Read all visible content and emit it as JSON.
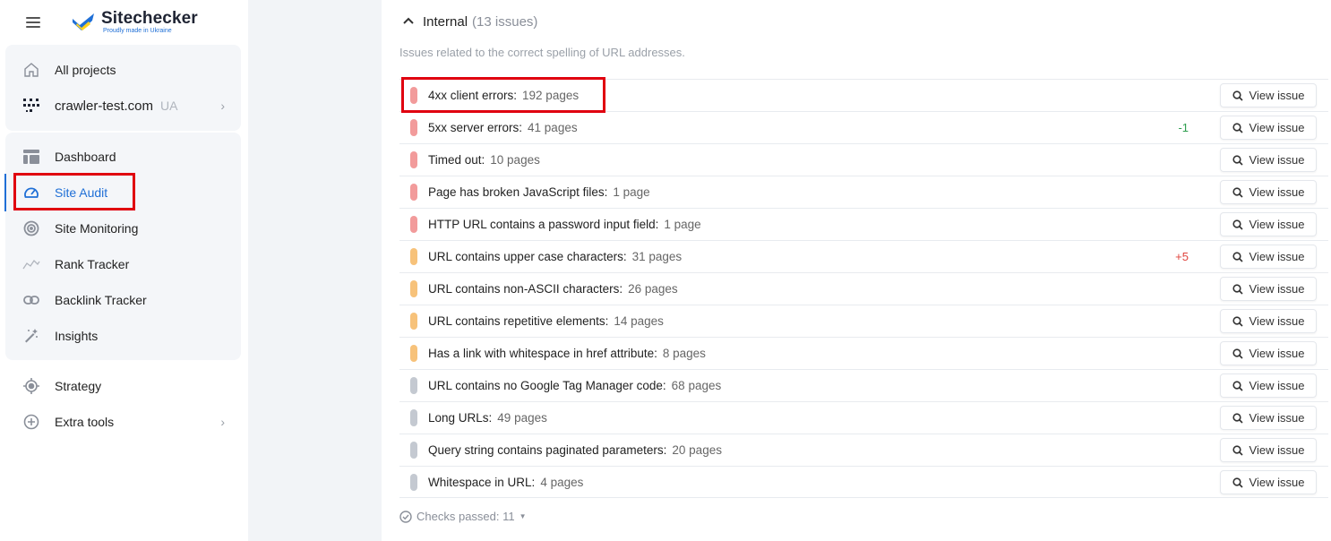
{
  "brand": {
    "name": "Sitechecker",
    "tagline": "Proudly made in Ukraine"
  },
  "sidebar": {
    "all_projects": "All projects",
    "project": {
      "name": "crawler-test.com",
      "region": "UA"
    },
    "items": [
      {
        "label": "Dashboard",
        "icon": "dashboard-icon"
      },
      {
        "label": "Site Audit",
        "icon": "gauge-icon",
        "active": true
      },
      {
        "label": "Site Monitoring",
        "icon": "radar-icon"
      },
      {
        "label": "Rank Tracker",
        "icon": "trend-icon"
      },
      {
        "label": "Backlink Tracker",
        "icon": "link-icon"
      },
      {
        "label": "Insights",
        "icon": "magic-wand-icon"
      }
    ],
    "strategy": "Strategy",
    "extra_tools": "Extra tools"
  },
  "section": {
    "title": "Internal",
    "count": "(13 issues)",
    "description": "Issues related to the correct spelling of URL addresses."
  },
  "issues": [
    {
      "name": "4xx client errors:",
      "pages": "192 pages",
      "severity": "critical",
      "delta": ""
    },
    {
      "name": "5xx server errors:",
      "pages": "41 pages",
      "severity": "critical",
      "delta": "-1"
    },
    {
      "name": "Timed out:",
      "pages": "10 pages",
      "severity": "critical",
      "delta": ""
    },
    {
      "name": "Page has broken JavaScript files:",
      "pages": "1 page",
      "severity": "critical",
      "delta": ""
    },
    {
      "name": "HTTP URL contains a password input field:",
      "pages": "1 page",
      "severity": "critical",
      "delta": ""
    },
    {
      "name": "URL contains upper case characters:",
      "pages": "31 pages",
      "severity": "warning",
      "delta": "+5"
    },
    {
      "name": "URL contains non-ASCII characters:",
      "pages": "26 pages",
      "severity": "warning",
      "delta": ""
    },
    {
      "name": "URL contains repetitive elements:",
      "pages": "14 pages",
      "severity": "warning",
      "delta": ""
    },
    {
      "name": "Has a link with whitespace in href attribute:",
      "pages": "8 pages",
      "severity": "warning",
      "delta": ""
    },
    {
      "name": "URL contains no Google Tag Manager code:",
      "pages": "68 pages",
      "severity": "notice",
      "delta": ""
    },
    {
      "name": "Long URLs:",
      "pages": "49 pages",
      "severity": "notice",
      "delta": ""
    },
    {
      "name": "Query string contains paginated parameters:",
      "pages": "20 pages",
      "severity": "notice",
      "delta": ""
    },
    {
      "name": "Whitespace in URL:",
      "pages": "4 pages",
      "severity": "notice",
      "delta": ""
    }
  ],
  "view_issue_label": "View issue",
  "checks_passed": "Checks passed: 11",
  "colors": {
    "critical": "#f29b9b",
    "warning": "#f7c27a",
    "notice": "#c4c9d1",
    "delta_negative": "#2e9e4f",
    "delta_positive": "#e0443e",
    "accent": "#1f6fd6",
    "highlight": "#e0000f"
  }
}
